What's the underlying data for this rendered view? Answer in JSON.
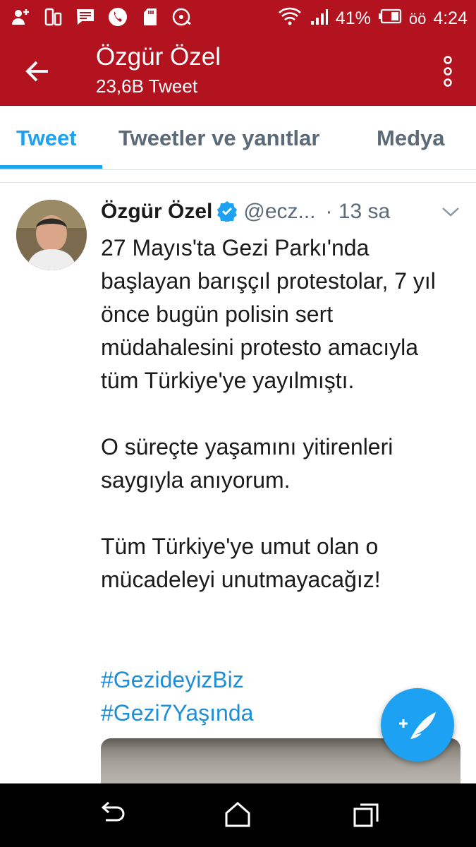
{
  "status_bar": {
    "left_icons": [
      "add-contact-icon",
      "phone-transfer-icon",
      "message-icon",
      "call-icon",
      "sd-card-icon",
      "disc-icon"
    ],
    "right_icons": [
      "wifi-icon",
      "signal-icon",
      "battery-icon"
    ],
    "battery": "41%",
    "time_prefix": "öö",
    "time": "4:24"
  },
  "app_bar": {
    "title": "Özgür Özel",
    "subtitle": "23,6B Tweet"
  },
  "tabs": [
    "Tweet",
    "Tweetler ve yanıtlar",
    "Medya"
  ],
  "tweet": {
    "name": "Özgür Özel",
    "handle": "@ecz...",
    "time": "· 13 sa",
    "text": "27 Mayıs'ta Gezi Parkı'nda başlayan barışçıl protestolar, 7 yıl önce bugün polisin sert müdahalesini protesto amacıyla tüm Türkiye'ye yayılmıştı.\n\nO süreçte yaşamını yitirenleri saygıyla anıyorum.\n\nTüm Türkiye'ye umut olan o mücadeleyi unutmayacağız!",
    "hashtags": [
      "#GezideyizBiz",
      "#Gezi7Yaşında"
    ]
  },
  "colors": {
    "app_bar": "#b3121f",
    "accent": "#1da1f2",
    "hashtag": "#1d8fd8"
  }
}
